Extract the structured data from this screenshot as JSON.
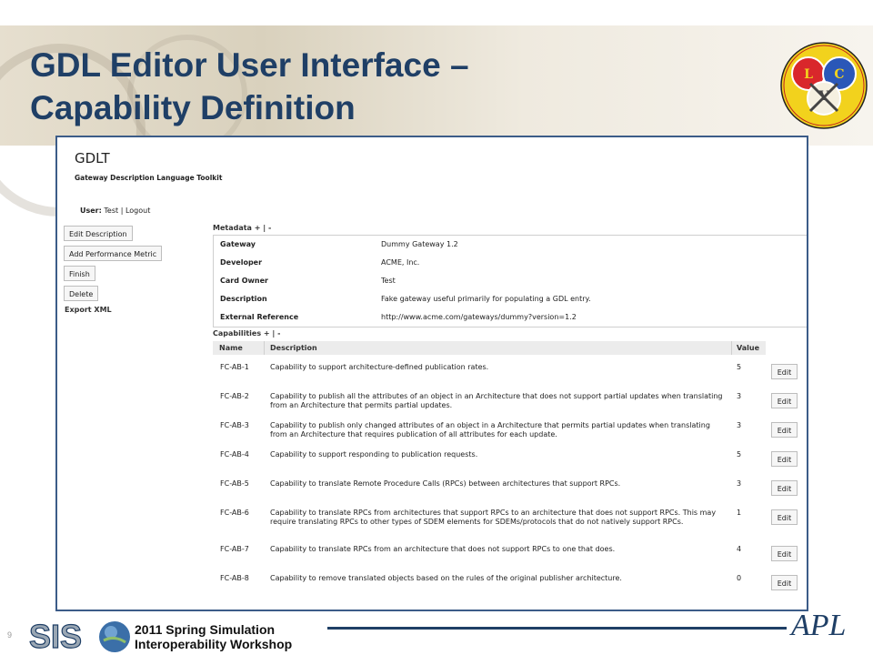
{
  "slide": {
    "title_line1": "GDL Editor User Interface –",
    "title_line2": "Capability Definition",
    "page_number": "9",
    "footer_line1": "2011 Spring Simulation",
    "footer_line2": "Interoperability Workshop",
    "colors": {
      "title": "#1f3f66",
      "frame_border": "#3c5c88",
      "footer_line": "#1f3f66"
    }
  },
  "app": {
    "title": "GDLT",
    "subtitle": "Gateway Description Language Toolkit",
    "user_label": "User:",
    "user_name": "Test",
    "separator": "|",
    "logout": "Logout"
  },
  "actions": {
    "edit_description": "Edit Description",
    "add_metric": "Add Performance Metric",
    "finish": "Finish",
    "delete": "Delete",
    "export_xml": "Export XML"
  },
  "metadata": {
    "header": "Metadata + | -",
    "rows": [
      {
        "key": "Gateway",
        "value": "Dummy Gateway 1.2"
      },
      {
        "key": "Developer",
        "value": "ACME, Inc."
      },
      {
        "key": "Card Owner",
        "value": "Test"
      },
      {
        "key": "Description",
        "value": "Fake gateway useful primarily for populating a GDL entry."
      },
      {
        "key": "External Reference",
        "value": "http://www.acme.com/gateways/dummy?version=1.2"
      }
    ]
  },
  "capabilities": {
    "header": "Capabilities + | -",
    "columns": {
      "name": "Name",
      "description": "Description",
      "value": "Value"
    },
    "edit_label": "Edit",
    "rows": [
      {
        "name": "FC-AB-1",
        "description": "Capability to support architecture-defined publication rates.",
        "value": "5"
      },
      {
        "name": "FC-AB-2",
        "description": "Capability to publish all the attributes of an object in an Architecture that does not support partial updates when translating from an Architecture that permits partial updates.",
        "value": "3"
      },
      {
        "name": "FC-AB-3",
        "description": "Capability to publish only changed attributes of an object in a Architecture that permits partial updates when translating from an Architecture that requires publication of all attributes for each update.",
        "value": "3"
      },
      {
        "name": "FC-AB-4",
        "description": "Capability to support responding to publication requests.",
        "value": "5"
      },
      {
        "name": "FC-AB-5",
        "description": "Capability to translate Remote Procedure Calls (RPCs) between architectures that support RPCs.",
        "value": "3"
      },
      {
        "name": "FC-AB-6",
        "description": "Capability to translate RPCs from architectures that support RPCs to an architecture that does not support RPCs. This may require translating RPCs to other types of SDEM elements for SDEMs/protocols that do not natively support RPCs.",
        "value": "1"
      },
      {
        "name": "FC-AB-7",
        "description": "Capability to translate RPCs from an architecture that does not support RPCs to one that does.",
        "value": "4"
      },
      {
        "name": "FC-AB-8",
        "description": "Capability to remove translated objects based on the rules of the original publisher architecture.",
        "value": "0"
      }
    ]
  }
}
